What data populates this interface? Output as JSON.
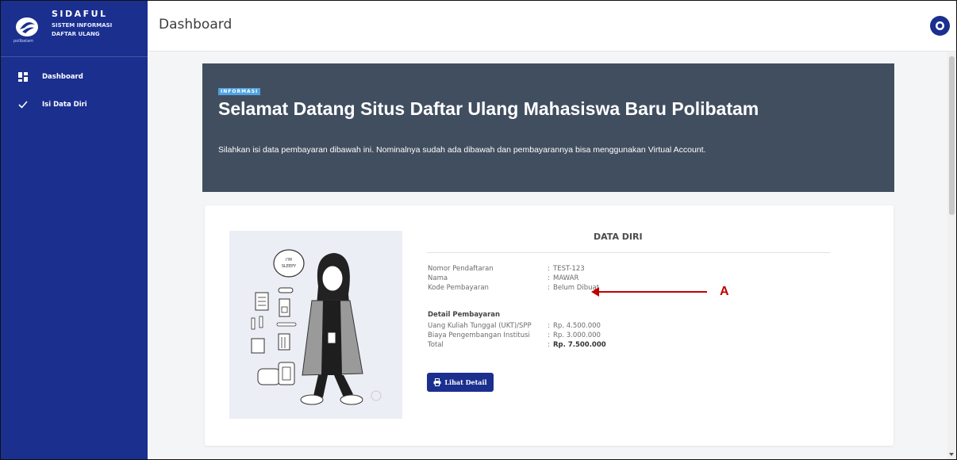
{
  "app": {
    "logo_text": "polibatam",
    "title": "SIDAFUL",
    "subtitle_line1": "SISTEM INFORMASI",
    "subtitle_line2": "DAFTAR ULANG"
  },
  "sidebar": {
    "items": [
      {
        "label": "Dashboard",
        "icon": "dashboard-grid-icon"
      },
      {
        "label": "Isi Data Diri",
        "icon": "checkmark-icon"
      }
    ]
  },
  "header": {
    "title": "Dashboard",
    "avatar_icon": "user-avatar-icon"
  },
  "banner": {
    "badge": "INFORMASI",
    "title": "Selamat Datang Situs Daftar Ulang Mahasiswa Baru Polibatam",
    "description": "Silahkan isi data pembayaran dibawah ini. Nominalnya sudah ada dibawah dan pembayarannya bisa menggunakan Virtual Account."
  },
  "data_diri": {
    "title": "DATA DIRI",
    "illustration_text": "I'M SLEEPY",
    "rows": [
      {
        "label": "Nomor Pendaftaran",
        "value": "TEST-123"
      },
      {
        "label": "Nama",
        "value": "MAWAR"
      },
      {
        "label": "Kode Pembayaran",
        "value": "Belum Dibuat"
      }
    ],
    "payment_title": "Detail Pembayaran",
    "payment_rows": [
      {
        "label": "Uang Kuliah Tunggal (UKT)/SPP",
        "value": "Rp. 4.500.000"
      },
      {
        "label": "Biaya Pengembangan Institusi",
        "value": "Rp. 3.000.000"
      },
      {
        "label": "Total",
        "value": "Rp. 7.500.000"
      }
    ],
    "button_label": "Lihat Detail"
  },
  "annotation": {
    "letter": "A",
    "color": "#c00000"
  },
  "colors": {
    "sidebar": "#1b2f8f",
    "banner": "#414e60",
    "badge": "#4fa3e0",
    "button": "#1b2f8f"
  }
}
